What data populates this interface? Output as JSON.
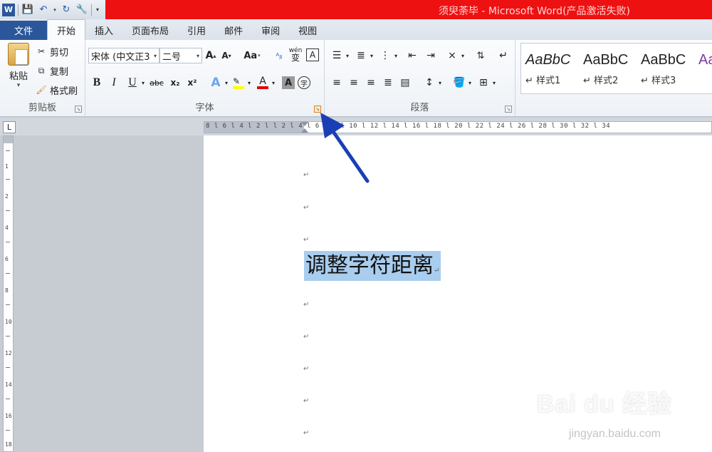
{
  "title_bar": {
    "title": "须臾荼毕 - Microsoft Word(产品激活失败)"
  },
  "tabs": [
    {
      "label": "文件"
    },
    {
      "label": "开始"
    },
    {
      "label": "插入"
    },
    {
      "label": "页面布局"
    },
    {
      "label": "引用"
    },
    {
      "label": "邮件"
    },
    {
      "label": "审阅"
    },
    {
      "label": "视图"
    }
  ],
  "clipboard": {
    "paste": "粘贴",
    "cut": "剪切",
    "copy": "复制",
    "format_painter": "格式刷",
    "group_label": "剪贴板"
  },
  "font": {
    "font_name": "宋体 (中文正3",
    "font_size": "二号",
    "group_label": "字体",
    "aa_label": "Aa",
    "wen_label": "wén",
    "wen_char": "变",
    "char_border": "A",
    "bold": "B",
    "italic": "I",
    "underline": "U",
    "strike": "abc",
    "subscript": "x₂",
    "superscript": "x²",
    "text_effect": "A",
    "font_color": "A",
    "char_shade": "A",
    "enclose": "字"
  },
  "paragraph": {
    "group_label": "段落"
  },
  "styles": {
    "items": [
      {
        "sample": "AaBbC",
        "name": "样式1"
      },
      {
        "sample": "AaBbC",
        "name": "样式2"
      },
      {
        "sample": "AaBbC",
        "name": "样式3"
      },
      {
        "sample": "Aa",
        "name": ""
      }
    ]
  },
  "ruler": {
    "h_numbers": "8 l 6 l 4 l 2 l   l 2 l 4 l 6 l 8 l 10 l 12 l 14 l 16 l 18 l 20 l 22 l 24 l 26 l 28 l 30 l 32 l 34",
    "corner": "L"
  },
  "document": {
    "selected_text": "调整字符距离",
    "paragraph_mark": "↵"
  },
  "watermark": {
    "brand": "Bai du 经验",
    "url": "jingyan.baidu.com"
  },
  "colors": {
    "title_red": "#ee1111",
    "file_tab": "#2b579a",
    "selection": "#a9cdee",
    "arrow": "#1a3fb5"
  }
}
